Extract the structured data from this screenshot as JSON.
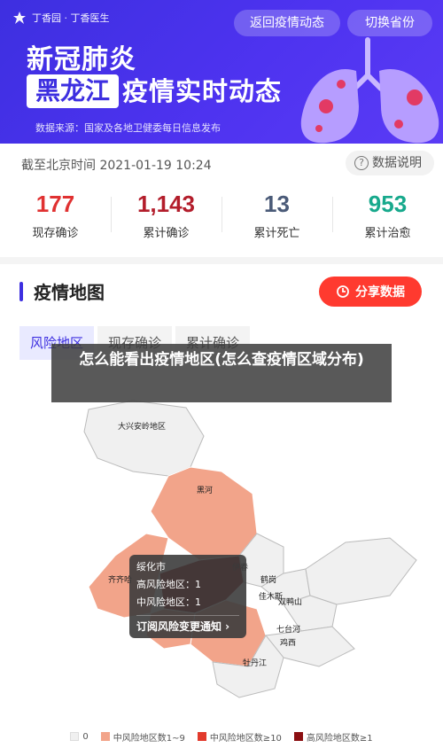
{
  "header": {
    "brand": "丁香园 · 丁香医生",
    "back_label": "返回疫情动态",
    "switch_label": "切换省份",
    "title_line1": "新冠肺炎",
    "province": "黑龙江",
    "title_line2": "疫情实时动态",
    "source": "数据来源：国家及各地卫健委每日信息发布"
  },
  "stats_bar": {
    "time_label": "截至北京时间 2021-01-19 10:24",
    "help_label": "数据说明",
    "items": [
      {
        "value": "177",
        "label": "现存确诊",
        "color": "#e03131"
      },
      {
        "value": "1,143",
        "label": "累计确诊",
        "color": "#b31d2b"
      },
      {
        "value": "13",
        "label": "累计死亡",
        "color": "#4a5a78"
      },
      {
        "value": "953",
        "label": "累计治愈",
        "color": "#17a98c"
      }
    ]
  },
  "map_section": {
    "title": "疫情地图",
    "share_label": "分享数据",
    "tabs": [
      "风险地区",
      "现存确诊",
      "累计确诊"
    ],
    "overlay_text": "怎么能看出疫情地区(怎么查疫情区域分布)",
    "cities": {
      "daxinganling": "大兴安岭地区",
      "heihe": "黑河",
      "qiqihar": "齐齐哈",
      "yichun": "伊春",
      "hegang": "鹤岗",
      "jiamusi": "佳木斯",
      "shuangyashan": "双鸭山",
      "qitaihe": "七台河",
      "jixi": "鸡西",
      "mudanjiang": "牡丹江"
    },
    "tooltip": {
      "city": "绥化市",
      "high_risk": "高风险地区：1",
      "mid_risk": "中风险地区：1",
      "subscribe": "订阅风险变更通知 ›"
    },
    "legend": [
      {
        "label": "0",
        "color": "#f0f0f0"
      },
      {
        "label": "中风险地区数1~9",
        "color": "#f2a48a"
      },
      {
        "label": "中风险地区数≥10",
        "color": "#e23a2c"
      },
      {
        "label": "高风险地区数≥1",
        "color": "#8b0f12"
      }
    ]
  }
}
